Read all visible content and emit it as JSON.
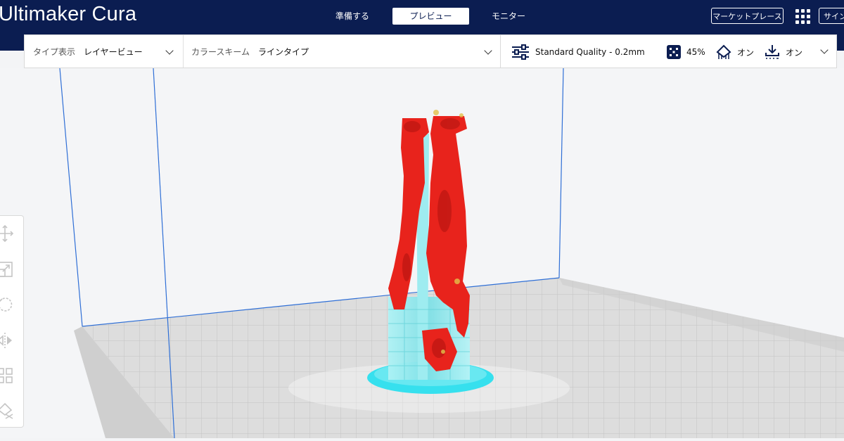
{
  "app": {
    "logo_strong": "Ultimaker",
    "logo_light": "Cura"
  },
  "header": {
    "stages": [
      {
        "label": "準備する",
        "active": false
      },
      {
        "label": "プレビュー",
        "active": true
      },
      {
        "label": "モニター",
        "active": false
      }
    ],
    "marketplace_label": "マーケットプレース",
    "signin_label": "サイン"
  },
  "view_bar": {
    "view_type_label": "タイプ表示",
    "view_type_value": "レイヤービュー",
    "color_scheme_label": "カラースキーム",
    "color_scheme_value": "ラインタイプ"
  },
  "print_setup": {
    "profile": "Standard Quality - 0.2mm",
    "infill": "45%",
    "support": "オン",
    "adhesion": "オン"
  },
  "left_toolbar": {
    "tools": [
      "move-icon",
      "scale-icon",
      "rotate-icon",
      "mirror-icon",
      "per-model-settings-icon",
      "support-blocker-icon"
    ]
  },
  "colors": {
    "header_bg": "#0b1d51",
    "model_wall": "#e8231c",
    "support": "#7fe0e6",
    "adhesion": "#36e0ee",
    "build_volume_edge": "#2f6fd6"
  }
}
